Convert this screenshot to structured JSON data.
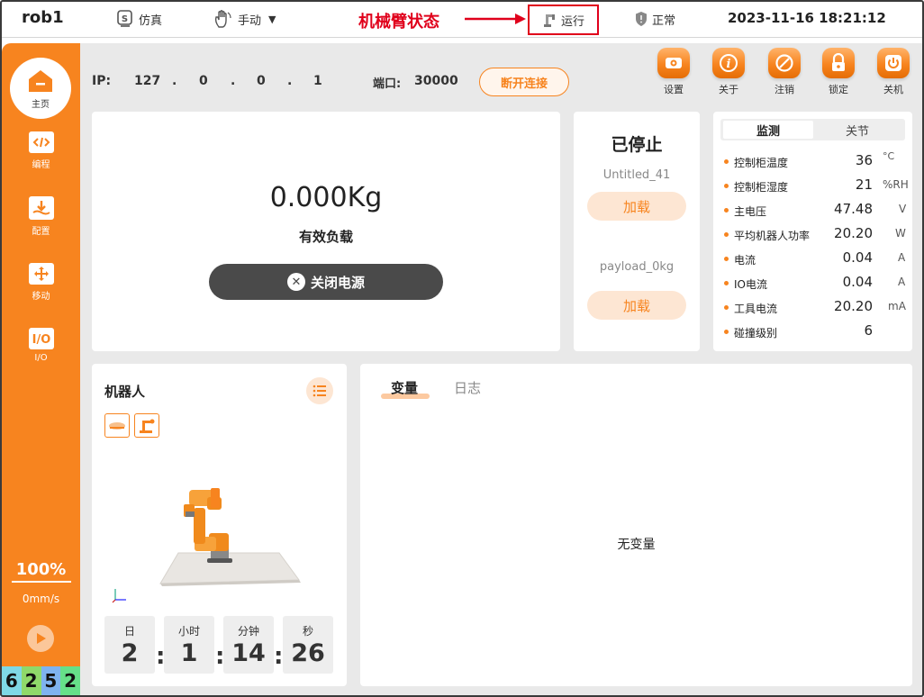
{
  "topbar": {
    "robot_name": "rob1",
    "sim_label": "仿真",
    "mode_label": "手动",
    "annotation_label": "机械臂状态",
    "run_state_label": "运行",
    "safety_label": "正常",
    "datetime": "2023-11-16 18:21:12"
  },
  "sidebar": {
    "home_label": "主页",
    "items": [
      {
        "label": "编程",
        "icon": "code-icon"
      },
      {
        "label": "配置",
        "icon": "config-icon"
      },
      {
        "label": "移动",
        "icon": "move-icon"
      },
      {
        "label": "I/O",
        "icon": "io-icon"
      }
    ],
    "speed_percent": "100%",
    "speed_mm": "0mm/s",
    "digits": [
      "6",
      "2",
      "5",
      "2"
    ],
    "digit_colors": [
      "#7fd8e6",
      "#8fd96a",
      "#7fb3f0",
      "#66e089"
    ]
  },
  "connection": {
    "ip_label": "IP:",
    "ip": [
      "127",
      "0",
      "0",
      "1"
    ],
    "port_label": "端口:",
    "port": "30000",
    "disconnect_label": "断开连接"
  },
  "toolbar": [
    {
      "label": "设置",
      "icon": "gear-icon"
    },
    {
      "label": "关于",
      "icon": "info-icon"
    },
    {
      "label": "注销",
      "icon": "logout-icon"
    },
    {
      "label": "锁定",
      "icon": "lock-icon"
    },
    {
      "label": "关机",
      "icon": "power-icon"
    }
  ],
  "payload": {
    "value": "0.000Kg",
    "label": "有效负载",
    "power_off_label": "关闭电源"
  },
  "program": {
    "status": "已停止",
    "program_name": "Untitled_41",
    "load_label_1": "加载",
    "payload_name": "payload_0kg",
    "load_label_2": "加载"
  },
  "monitor": {
    "tab_active": "监测",
    "tab_inactive": "关节",
    "rows": [
      {
        "name": "控制柜温度",
        "value": "36",
        "unit": "°C"
      },
      {
        "name": "控制柜湿度",
        "value": "21",
        "unit": "%RH"
      },
      {
        "name": "主电压",
        "value": "47.48",
        "unit": "V"
      },
      {
        "name": "平均机器人功率",
        "value": "20.20",
        "unit": "W"
      },
      {
        "name": "电流",
        "value": "0.04",
        "unit": "A"
      },
      {
        "name": "IO电流",
        "value": "0.04",
        "unit": "A"
      },
      {
        "name": "工具电流",
        "value": "20.20",
        "unit": "mA"
      },
      {
        "name": "碰撞级别",
        "value": "6",
        "unit": ""
      }
    ]
  },
  "robot_panel": {
    "title": "机器人",
    "timer": [
      {
        "label": "日",
        "value": "2"
      },
      {
        "label": "小时",
        "value": "1"
      },
      {
        "label": "分钟",
        "value": "14"
      },
      {
        "label": "秒",
        "value": "26"
      }
    ],
    "separator": ":"
  },
  "variables": {
    "tab_active": "变量",
    "tab_inactive": "日志",
    "empty_text": "无变量"
  },
  "colors": {
    "accent": "#f7841f",
    "annotation": "#e0001b",
    "dark_button": "#4a4a4a"
  }
}
